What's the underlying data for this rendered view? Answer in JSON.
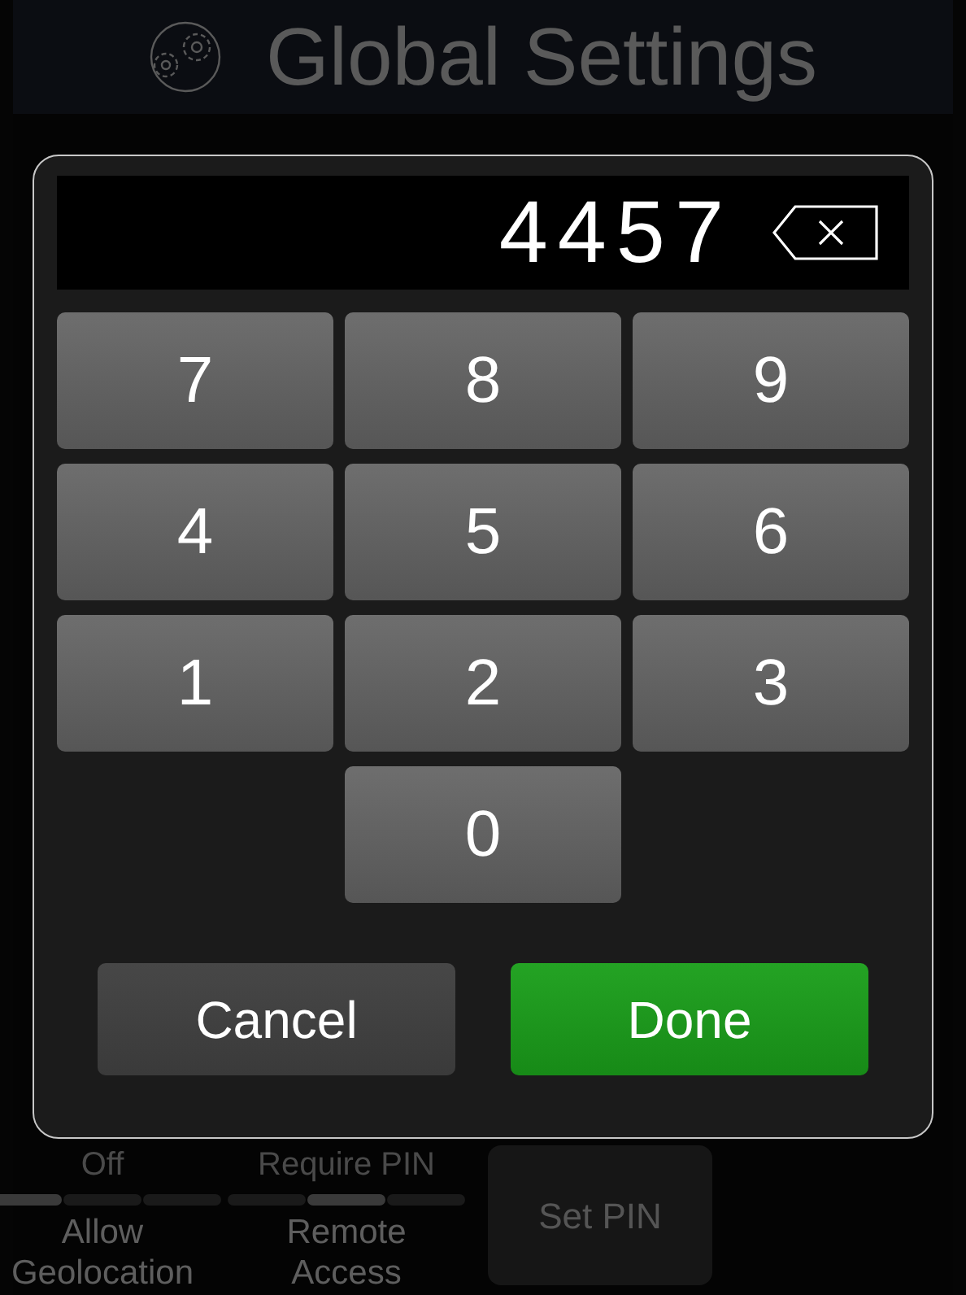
{
  "header": {
    "title": "Global Settings"
  },
  "background_controls": [
    {
      "kind": "segmented",
      "value": "Off",
      "label": "Allow Geolocation",
      "segments": [
        {
          "selected": true
        },
        {
          "selected": false
        },
        {
          "selected": false
        }
      ]
    },
    {
      "kind": "segmented",
      "value": "Require PIN",
      "label": "Remote Access",
      "segments": [
        {
          "selected": false
        },
        {
          "selected": true
        },
        {
          "selected": false
        }
      ]
    },
    {
      "kind": "button",
      "label": "Set PIN"
    }
  ],
  "pin_dialog": {
    "value": "4457",
    "keys": [
      "7",
      "8",
      "9",
      "4",
      "5",
      "6",
      "1",
      "2",
      "3",
      "0"
    ],
    "buttons": [
      {
        "label": "Cancel",
        "kind": "secondary"
      },
      {
        "label": "Done",
        "kind": "primary"
      }
    ]
  }
}
